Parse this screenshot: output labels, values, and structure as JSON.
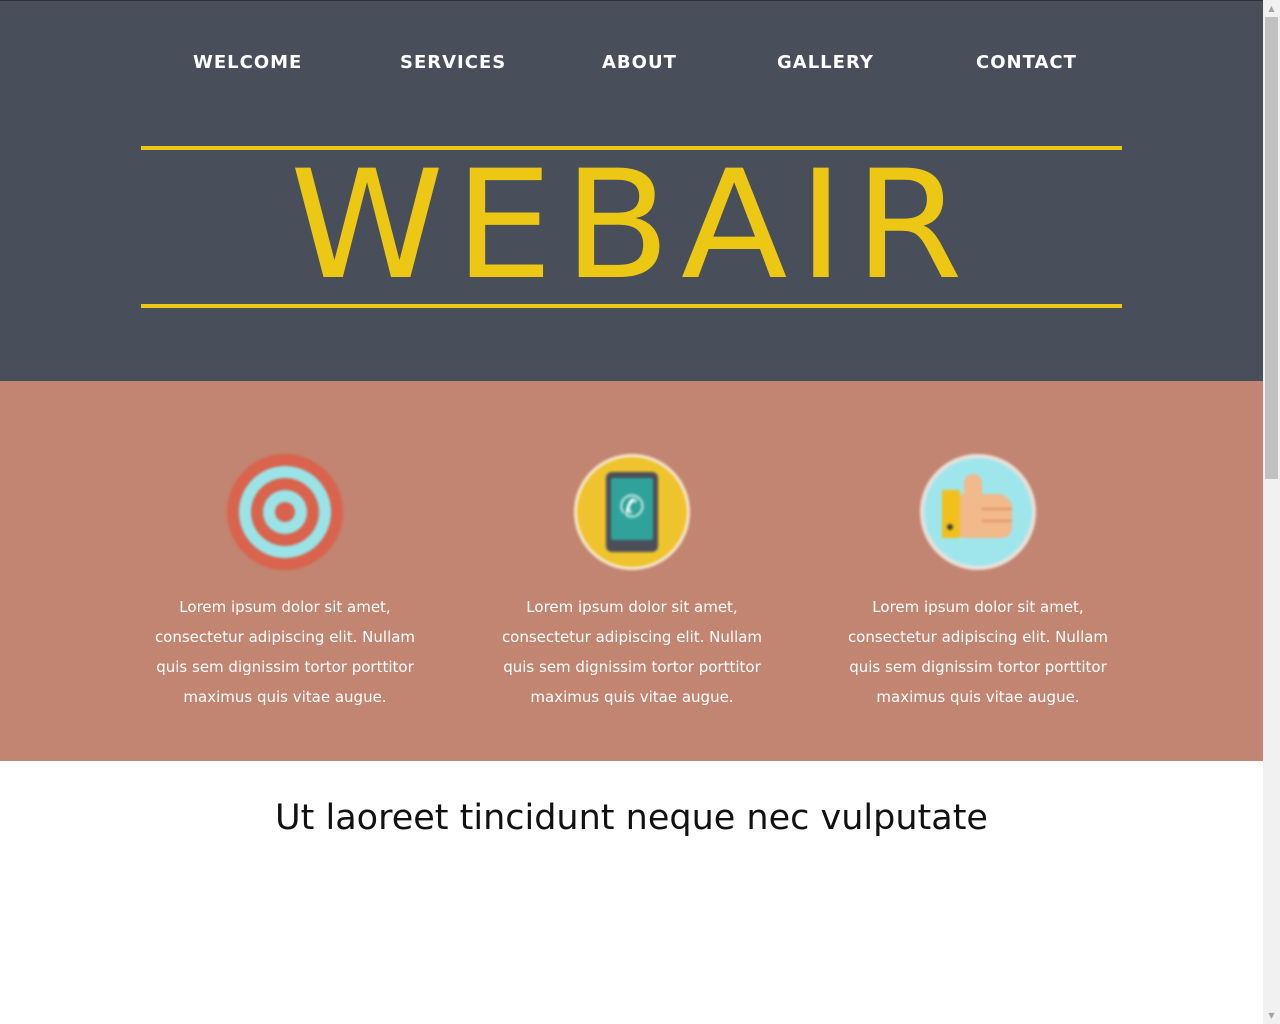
{
  "nav": {
    "items": [
      {
        "label": "WELCOME"
      },
      {
        "label": "SERVICES"
      },
      {
        "label": "ABOUT"
      },
      {
        "label": "GALLERY"
      },
      {
        "label": "CONTACT"
      }
    ]
  },
  "hero": {
    "logo_text": "WEBAIR"
  },
  "features": [
    {
      "icon": "target-icon",
      "text": "Lorem ipsum dolor sit amet, consectetur adipiscing elit. Nullam quis sem dignissim tortor porttitor maximus quis vitae augue."
    },
    {
      "icon": "phone-icon",
      "text": "Lorem ipsum dolor sit amet, consectetur adipiscing elit. Nullam quis sem dignissim tortor porttitor maximus quis vitae augue."
    },
    {
      "icon": "thumbs-up-icon",
      "text": "Lorem ipsum dolor sit amet, consectetur adipiscing elit. Nullam quis sem dignissim tortor porttitor maximus quis vitae augue."
    }
  ],
  "section": {
    "heading": "Ut laoreet tincidunt neque nec vulputate"
  },
  "scrollbar": {
    "up_glyph": "▲",
    "down_glyph": "▼"
  },
  "colors": {
    "header_bg": "#484e5a",
    "accent_yellow": "#ecc814",
    "features_bg": "#c28571",
    "text_light": "#ffffff"
  }
}
